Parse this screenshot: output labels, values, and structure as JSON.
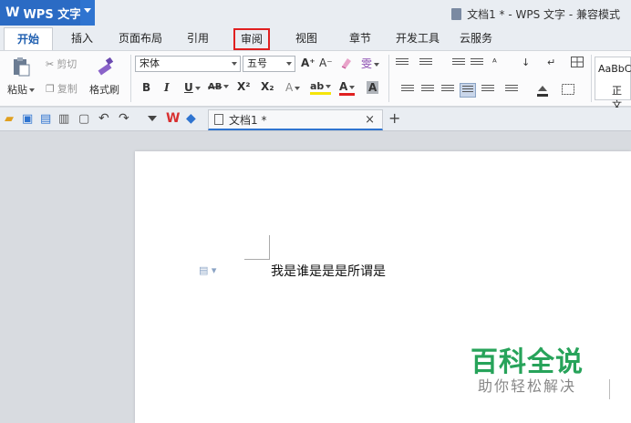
{
  "titlebar": {
    "app_name": "WPS 文字",
    "doc_title": "文档1 * - WPS 文字 - 兼容模式"
  },
  "tabs": [
    {
      "label": "开始",
      "state": "active"
    },
    {
      "label": "插入"
    },
    {
      "label": "页面布局"
    },
    {
      "label": "引用"
    },
    {
      "label": "审阅",
      "state": "highlighted"
    },
    {
      "label": "视图"
    },
    {
      "label": "章节"
    },
    {
      "label": "开发工具"
    },
    {
      "label": "云服务"
    }
  ],
  "ribbon": {
    "clipboard": {
      "paste_label": "粘贴",
      "cut_label": "剪切",
      "copy_label": "复制",
      "format_painter_label": "格式刷"
    },
    "font": {
      "font_name": "宋体",
      "font_size": "五号",
      "grow_label": "A⁺",
      "shrink_label": "A⁻",
      "wen_label": "雯",
      "bold": "B",
      "italic": "I",
      "underline": "U",
      "strike": "AB",
      "superscript": "X²",
      "subscript": "X₂",
      "text_effect": "A",
      "highlight": "ab",
      "font_color": "A",
      "char_shading": "A"
    },
    "styles": {
      "preview": "AaBbC",
      "normal": "正文"
    }
  },
  "docbar": {
    "doc_tab_label": "文档1 *",
    "close": "×",
    "new_tab": "+"
  },
  "document": {
    "text": "我是谁是是是所谓是"
  },
  "watermark": {
    "main": "百科全说",
    "sub": "助你轻松解决"
  },
  "colors": {
    "app_blue": "#2b6bc4",
    "highlight_red": "#e02020",
    "watermark_green": "#27a35a"
  }
}
